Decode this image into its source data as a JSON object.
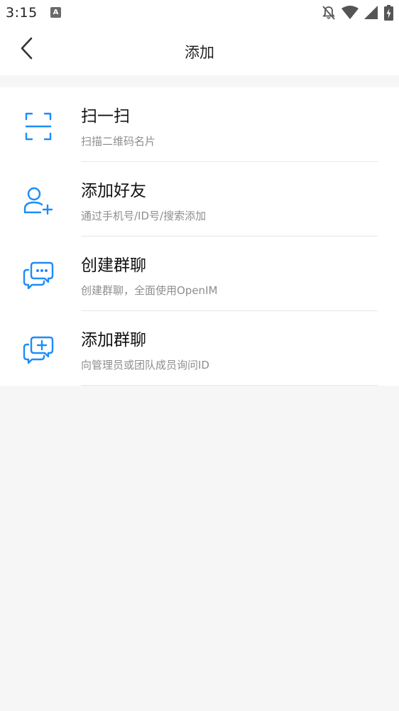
{
  "status_bar": {
    "time": "3:15",
    "app_icon_letter": "A",
    "icons": [
      "notifications-off-icon",
      "wifi-icon",
      "signal-icon",
      "battery-charging-icon"
    ]
  },
  "header": {
    "title": "添加",
    "back_icon": "chevron-left-icon"
  },
  "menu": {
    "items": [
      {
        "title": "扫一扫",
        "subtitle": "扫描二维码名片",
        "icon": "scan-icon"
      },
      {
        "title": "添加好友",
        "subtitle": "通过手机号/ID号/搜索添加",
        "icon": "add-user-icon"
      },
      {
        "title": "创建群聊",
        "subtitle": "创建群聊，全面使用OpenIM",
        "icon": "group-chat-icon"
      },
      {
        "title": "添加群聊",
        "subtitle": "向管理员或团队成员询问ID",
        "icon": "join-group-icon"
      }
    ]
  },
  "colors": {
    "accent": "#1d8cf8",
    "background": "#f6f6f6",
    "surface": "#ffffff",
    "subtitle": "#8e8e8e",
    "divider": "#e6e6e6"
  }
}
